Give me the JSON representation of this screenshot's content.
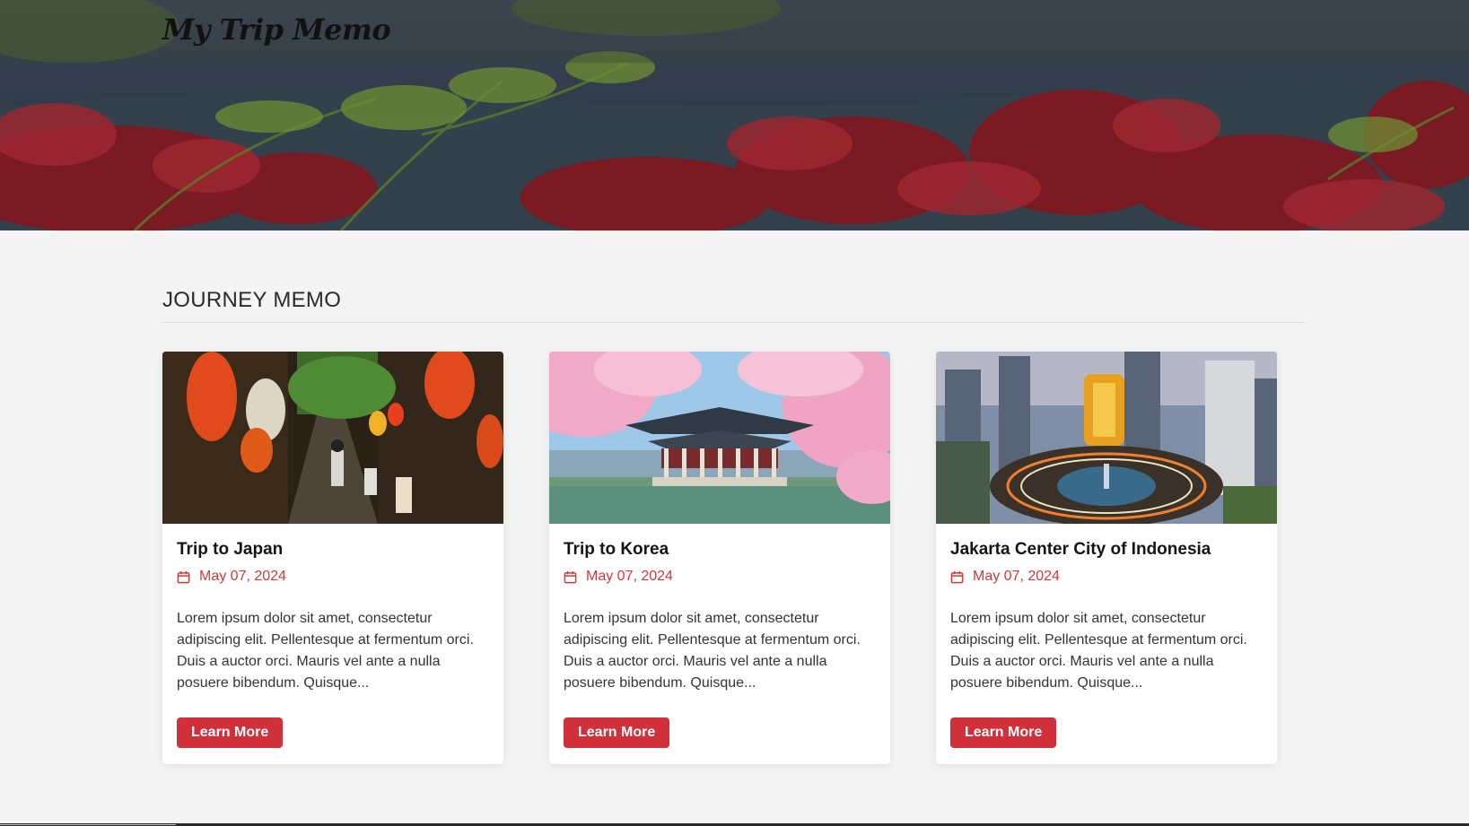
{
  "brand": {
    "logo_text": "My Trip Memo"
  },
  "section": {
    "title": "JOURNEY MEMO"
  },
  "cards": [
    {
      "image": "japan-alley-lanterns",
      "title": "Trip to Japan",
      "date": "May 07, 2024",
      "excerpt": "Lorem ipsum dolor sit amet, consectetur adipiscing elit. Pellentesque at fermentum orci. Duis a auctor orci. Mauris vel ante a nulla posuere bibendum. Quisque...",
      "button_label": "Learn More"
    },
    {
      "image": "korea-palace-cherry-blossom",
      "title": "Trip to Korea",
      "date": "May 07, 2024",
      "excerpt": "Lorem ipsum dolor sit amet, consectetur adipiscing elit. Pellentesque at fermentum orci. Duis a auctor orci. Mauris vel ante a nulla posuere bibendum. Quisque...",
      "button_label": "Learn More"
    },
    {
      "image": "jakarta-city-roundabout",
      "title": "Jakarta Center City of Indonesia",
      "date": "May 07, 2024",
      "excerpt": "Lorem ipsum dolor sit amet, consectetur adipiscing elit. Pellentesque at fermentum orci. Duis a auctor orci. Mauris vel ante a nulla posuere bibendum. Quisque...",
      "button_label": "Learn More"
    }
  ],
  "colors": {
    "accent": "#d0303a",
    "date": "#d03a3a",
    "background": "#f4f4f4"
  },
  "icons": {
    "date_icon": "calendar-icon"
  }
}
